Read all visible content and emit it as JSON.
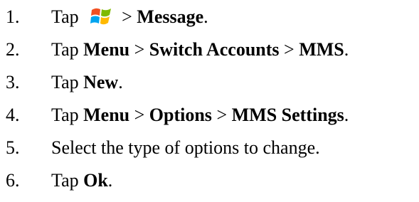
{
  "steps": [
    {
      "number": "1.",
      "parts": [
        {
          "text": "Tap "
        },
        {
          "icon": "windows-start-icon"
        },
        {
          "text": "> "
        },
        {
          "text": "Message",
          "bold": true
        },
        {
          "text": "."
        }
      ]
    },
    {
      "number": "2.",
      "parts": [
        {
          "text": "Tap "
        },
        {
          "text": "Menu",
          "bold": true
        },
        {
          "text": " > "
        },
        {
          "text": "Switch Accounts",
          "bold": true
        },
        {
          "text": " > "
        },
        {
          "text": "MMS",
          "bold": true
        },
        {
          "text": "."
        }
      ]
    },
    {
      "number": "3.",
      "parts": [
        {
          "text": "Tap "
        },
        {
          "text": "New",
          "bold": true
        },
        {
          "text": "."
        }
      ]
    },
    {
      "number": "4.",
      "parts": [
        {
          "text": "Tap "
        },
        {
          "text": "Menu",
          "bold": true
        },
        {
          "text": " > "
        },
        {
          "text": "Options",
          "bold": true
        },
        {
          "text": " > "
        },
        {
          "text": "MMS Settings",
          "bold": true
        },
        {
          "text": "."
        }
      ]
    },
    {
      "number": "5.",
      "parts": [
        {
          "text": "Select the type of options to change."
        }
      ]
    },
    {
      "number": "6.",
      "parts": [
        {
          "text": "Tap "
        },
        {
          "text": "Ok",
          "bold": true
        },
        {
          "text": "."
        }
      ]
    }
  ]
}
